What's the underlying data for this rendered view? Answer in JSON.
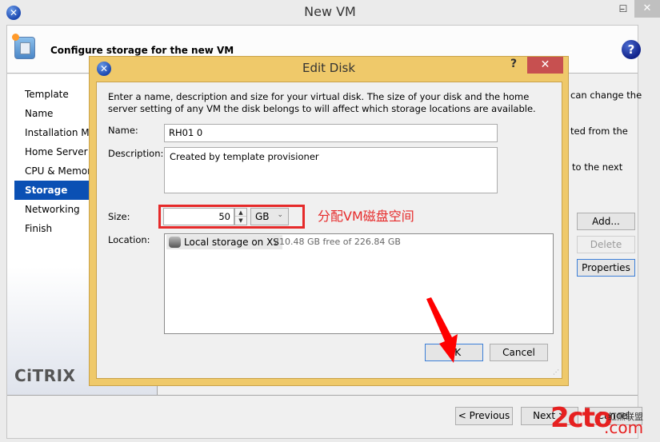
{
  "window": {
    "title": "New VM",
    "app_icon": "xencenter-icon",
    "controls": {
      "minimize": "–",
      "maximize": "☐",
      "close": "✕"
    }
  },
  "header": {
    "title": "Configure storage for the new VM",
    "help_icon": "?"
  },
  "sidebar": {
    "items": [
      {
        "label": "Template",
        "active": false
      },
      {
        "label": "Name",
        "active": false
      },
      {
        "label": "Installation Media",
        "active": false
      },
      {
        "label": "Home Server",
        "active": false
      },
      {
        "label": "CPU & Memory",
        "active": false
      },
      {
        "label": "Storage",
        "active": true
      },
      {
        "label": "Networking",
        "active": false
      },
      {
        "label": "Finish",
        "active": false
      }
    ],
    "logo": "CiTRIX"
  },
  "background_content": {
    "text_fragments": [
      "can change the",
      "ted from the",
      "to the next"
    ],
    "buttons": {
      "add": "Add...",
      "delete": "Delete",
      "properties": "Properties"
    }
  },
  "footer": {
    "previous": "< Previous",
    "next": "Next >",
    "cancel": "Cancel"
  },
  "dialog": {
    "title": "Edit Disk",
    "help": "?",
    "close": "✕",
    "intro": "Enter a name, description and size for your virtual disk. The size of your disk and the home server setting of any VM the disk belongs to will affect which storage locations are available.",
    "name_label": "Name:",
    "name_value": "RH01 0",
    "description_label": "Description:",
    "description_value": "Created by template provisioner",
    "size_label": "Size:",
    "size_value": "50",
    "size_unit": "GB",
    "location_label": "Location:",
    "location_item": {
      "name": "Local storage on XS",
      "free": "210.48 GB free of 226.84 GB"
    },
    "ok": "OK",
    "cancel": "Cancel"
  },
  "annotation": {
    "text": "分配VM磁盘空间",
    "color": "#e62a2a"
  },
  "watermark": {
    "brand": "2cto",
    "domain": ".com",
    "cn_text": "红黑联盟"
  }
}
